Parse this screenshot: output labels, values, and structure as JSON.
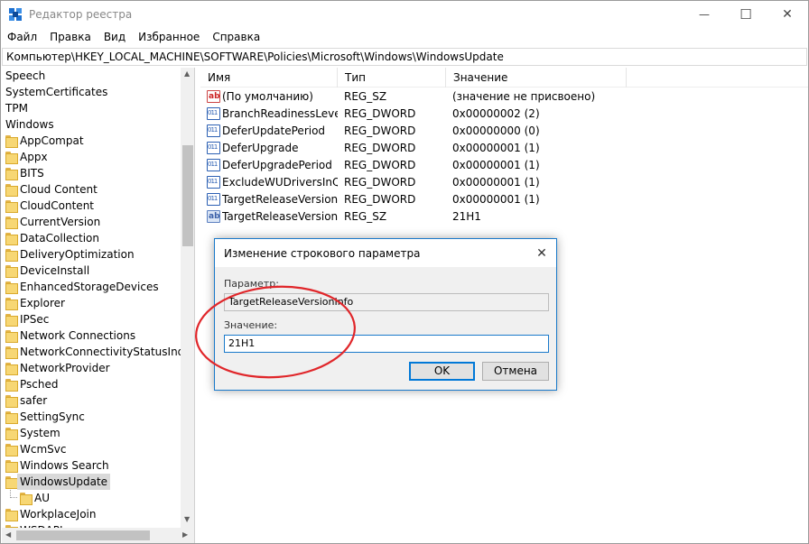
{
  "window": {
    "title": "Редактор реестра",
    "controls": {
      "minimize": "—",
      "maximize": "☐",
      "close": "✕"
    }
  },
  "menu": [
    "Файл",
    "Правка",
    "Вид",
    "Избранное",
    "Справка"
  ],
  "address": "Компьютер\\HKEY_LOCAL_MACHINE\\SOFTWARE\\Policies\\Microsoft\\Windows\\WindowsUpdate",
  "tree": {
    "top_items": [
      "Speech",
      "SystemCertificates",
      "TPM",
      "Windows"
    ],
    "folders": [
      "AppCompat",
      "Appx",
      "BITS",
      "Cloud Content",
      "CloudContent",
      "CurrentVersion",
      "DataCollection",
      "DeliveryOptimization",
      "DeviceInstall",
      "EnhancedStorageDevices",
      "Explorer",
      "IPSec",
      "Network Connections",
      "NetworkConnectivityStatusIndicator",
      "NetworkProvider",
      "Psched",
      "safer",
      "SettingSync",
      "System",
      "WcmSvc",
      "Windows Search",
      "WindowsUpdate"
    ],
    "selected": "WindowsUpdate",
    "child": "AU",
    "after": "WorkplaceJoin",
    "partial": "WSDAPI"
  },
  "list": {
    "columns": [
      "Имя",
      "Тип",
      "Значение"
    ],
    "rows": [
      {
        "icon": "string-value-icon",
        "name": "(По умолчанию)",
        "type": "REG_SZ",
        "value": "(значение не присвоено)"
      },
      {
        "icon": "dword-value-icon",
        "name": "BranchReadinessLevel",
        "type": "REG_DWORD",
        "value": "0x00000002 (2)"
      },
      {
        "icon": "dword-value-icon",
        "name": "DeferUpdatePeriod",
        "type": "REG_DWORD",
        "value": "0x00000000 (0)"
      },
      {
        "icon": "dword-value-icon",
        "name": "DeferUpgrade",
        "type": "REG_DWORD",
        "value": "0x00000001 (1)"
      },
      {
        "icon": "dword-value-icon",
        "name": "DeferUpgradePeriod",
        "type": "REG_DWORD",
        "value": "0x00000001 (1)"
      },
      {
        "icon": "dword-value-icon",
        "name": "ExcludeWUDriversInQ...",
        "type": "REG_DWORD",
        "value": "0x00000001 (1)"
      },
      {
        "icon": "dword-value-icon",
        "name": "TargetReleaseVersion",
        "type": "REG_DWORD",
        "value": "0x00000001 (1)"
      },
      {
        "icon": "string-value-icon",
        "name": "TargetReleaseVersionI...",
        "type": "REG_SZ",
        "value": "21H1"
      }
    ]
  },
  "dialog": {
    "title": "Изменение строкового параметра",
    "param_label": "Параметр:",
    "param_value": "TargetReleaseVersionInfo",
    "value_label": "Значение:",
    "value": "21H1",
    "ok": "OK",
    "cancel": "Отмена",
    "close": "✕"
  },
  "colors": {
    "accent": "#1979ca",
    "annotation": "#e0262a",
    "folder": "#f7d774"
  }
}
